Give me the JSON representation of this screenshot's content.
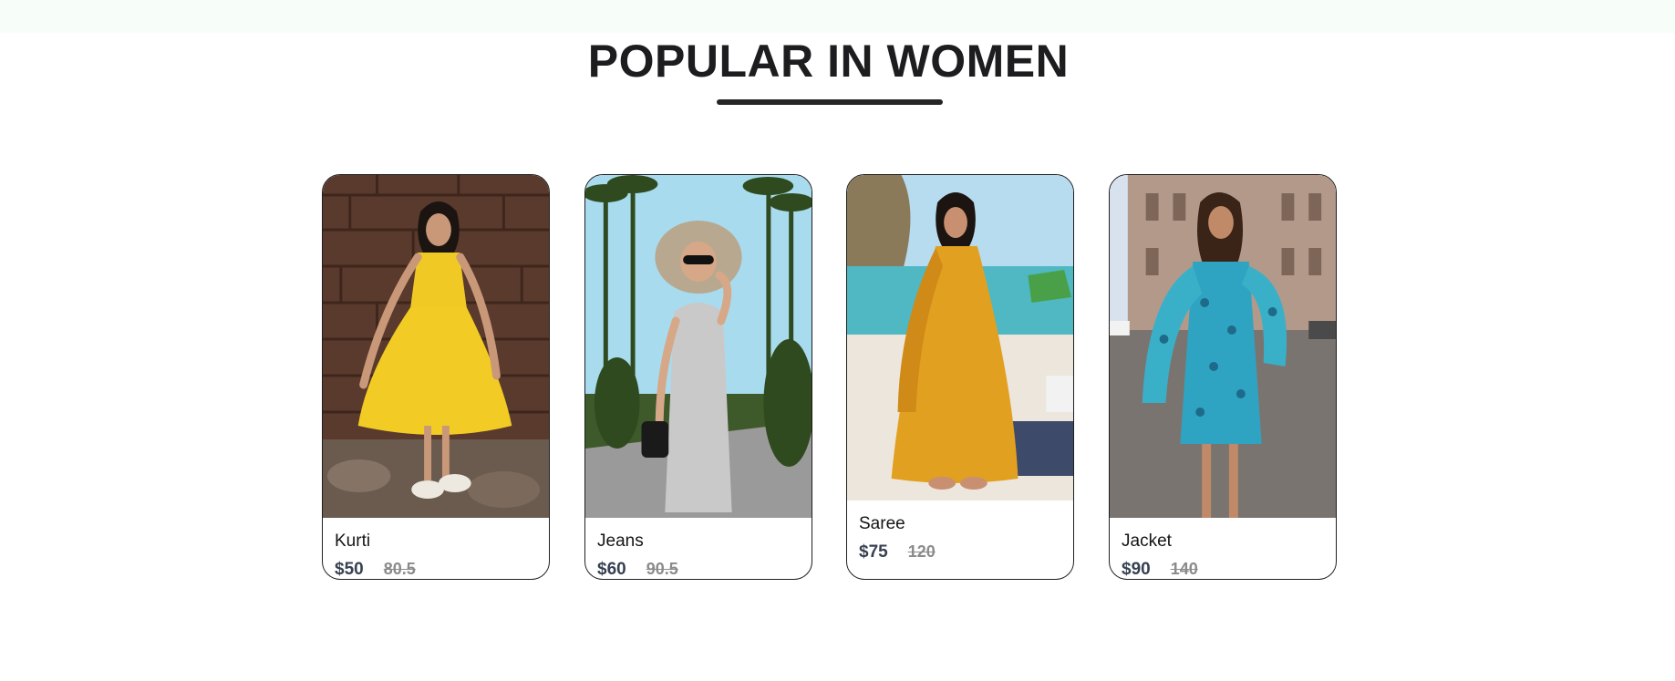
{
  "section": {
    "title": "POPULAR IN WOMEN"
  },
  "products": [
    {
      "name": "Kurti",
      "new_price": "$50",
      "old_price": "80.5",
      "image_icon": "woman-yellow-dress-photo"
    },
    {
      "name": "Jeans",
      "new_price": "$60",
      "old_price": "90.5",
      "image_icon": "woman-grey-dress-hat-photo"
    },
    {
      "name": "Saree",
      "new_price": "$75",
      "old_price": "120",
      "image_icon": "woman-orange-kurta-beach-photo"
    },
    {
      "name": "Jacket",
      "new_price": "$90",
      "old_price": "140",
      "image_icon": "woman-floral-dress-street-photo"
    }
  ],
  "colors": {
    "title": "#1d1d1f",
    "underline": "#252525",
    "price_new": "#374151",
    "price_old": "#8b8b8b",
    "card_border": "#1f1f1f"
  }
}
